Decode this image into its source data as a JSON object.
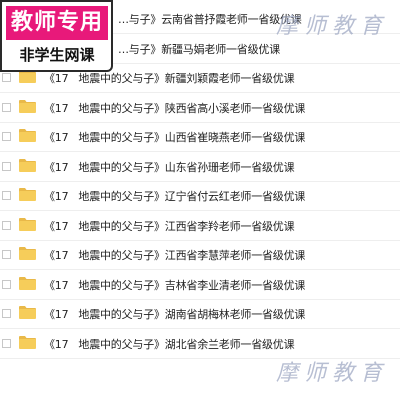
{
  "badge": {
    "line1": "教师专用",
    "line2": "非学生网课"
  },
  "watermark_text": "摩师教育",
  "files": [
    {
      "prefix": "",
      "name": "…与子》云南省普抒霞老师一省级优课"
    },
    {
      "prefix": "",
      "name": "…与子》新疆马娟老师一省级优课"
    },
    {
      "prefix": "《17",
      "name": "地震中的父与子》新疆刘颖霞老师一省级优课"
    },
    {
      "prefix": "《17",
      "name": "地震中的父与子》陕西省高小溪老师一省级优课"
    },
    {
      "prefix": "《17",
      "name": "地震中的父与子》山西省崔晓燕老师一省级优课"
    },
    {
      "prefix": "《17",
      "name": "地震中的父与子》山东省孙珊老师一省级优课"
    },
    {
      "prefix": "《17",
      "name": "地震中的父与子》辽宁省付云红老师一省级优课"
    },
    {
      "prefix": "《17",
      "name": "地震中的父与子》江西省李羚老师一省级优课"
    },
    {
      "prefix": "《17",
      "name": "地震中的父与子》江西省李慧萍老师一省级优课"
    },
    {
      "prefix": "《17",
      "name": "地震中的父与子》吉林省李业清老师一省级优课"
    },
    {
      "prefix": "《17",
      "name": "地震中的父与子》湖南省胡梅林老师一省级优课"
    },
    {
      "prefix": "《17",
      "name": "地震中的父与子》湖北省余兰老师一省级优课"
    }
  ]
}
